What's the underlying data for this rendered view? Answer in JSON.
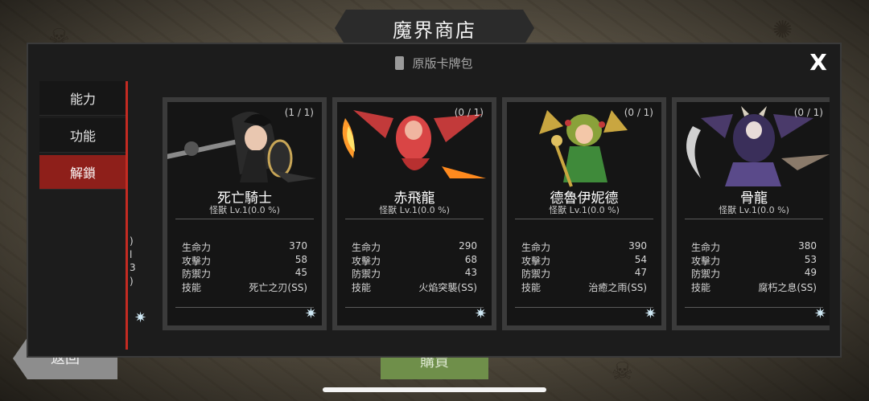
{
  "screen": {
    "title": "魔界商店",
    "back_label": "返回",
    "buy_label": "購買"
  },
  "panel": {
    "pack_label": "原版卡牌包",
    "close_label": "X"
  },
  "menu": {
    "items": [
      {
        "label": "能力",
        "active": false
      },
      {
        "label": "功能",
        "active": false
      },
      {
        "label": "解鎖",
        "active": true
      }
    ]
  },
  "partial_card": {
    "stat_fragments": [
      ")",
      "l",
      "3",
      ")"
    ]
  },
  "stat_labels": {
    "hp": "生命力",
    "atk": "攻擊力",
    "def": "防禦力",
    "skill": "技能"
  },
  "cards": [
    {
      "count": "(1 / 1)",
      "name": "死亡騎士",
      "subtitle": "怪獸 Lv.1(0.0 %)",
      "hp": "370",
      "atk": "58",
      "def": "45",
      "skill": "死亡之刃(SS)",
      "star_icon": "star-icon"
    },
    {
      "count": "(0 / 1)",
      "name": "赤飛龍",
      "subtitle": "怪獸 Lv.1(0.0 %)",
      "hp": "290",
      "atk": "68",
      "def": "43",
      "skill": "火焰突襲(SS)",
      "star_icon": "star-icon"
    },
    {
      "count": "(0 / 1)",
      "name": "德魯伊妮德",
      "subtitle": "怪獸 Lv.1(0.0 %)",
      "hp": "390",
      "atk": "54",
      "def": "47",
      "skill": "治癒之雨(SS)",
      "star_icon": "star-icon"
    },
    {
      "count": "(0 / 1)",
      "name": "骨龍",
      "subtitle": "怪獸 Lv.1(0.0 %)",
      "hp": "380",
      "atk": "53",
      "def": "49",
      "skill": "腐朽之息(SS)",
      "star_icon": "star-icon"
    }
  ],
  "colors": {
    "accent_red": "#c42b22",
    "menu_active": "#8e1f1a"
  }
}
